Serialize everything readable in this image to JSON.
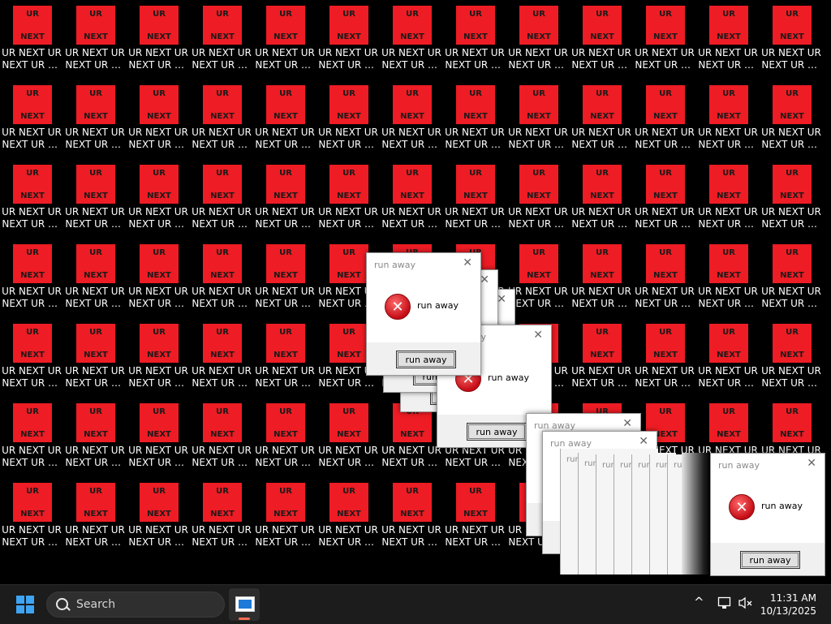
{
  "desktop": {
    "icon_top_text": "UR",
    "icon_bottom_text": "NEXT",
    "icon_label": "UR NEXT UR NEXT UR NEXT UR NEXT",
    "icon_color": "#ee1c24",
    "grid_columns": 13,
    "grid_rows": 7
  },
  "dialogs": {
    "title": "run away",
    "message": "run away",
    "button_label": "run away",
    "close_symbol": "✕",
    "error_symbol": "✕",
    "error_icon": "error-x-icon"
  },
  "taskbar": {
    "search_placeholder": "Search",
    "start_icon": "windows-logo-icon",
    "app_icon": "app-window-icon",
    "tray_chevron": "^",
    "tray_icons": [
      "network-icon",
      "volume-muted-icon"
    ],
    "time": "11:31 AM",
    "date": "10/13/2025"
  }
}
